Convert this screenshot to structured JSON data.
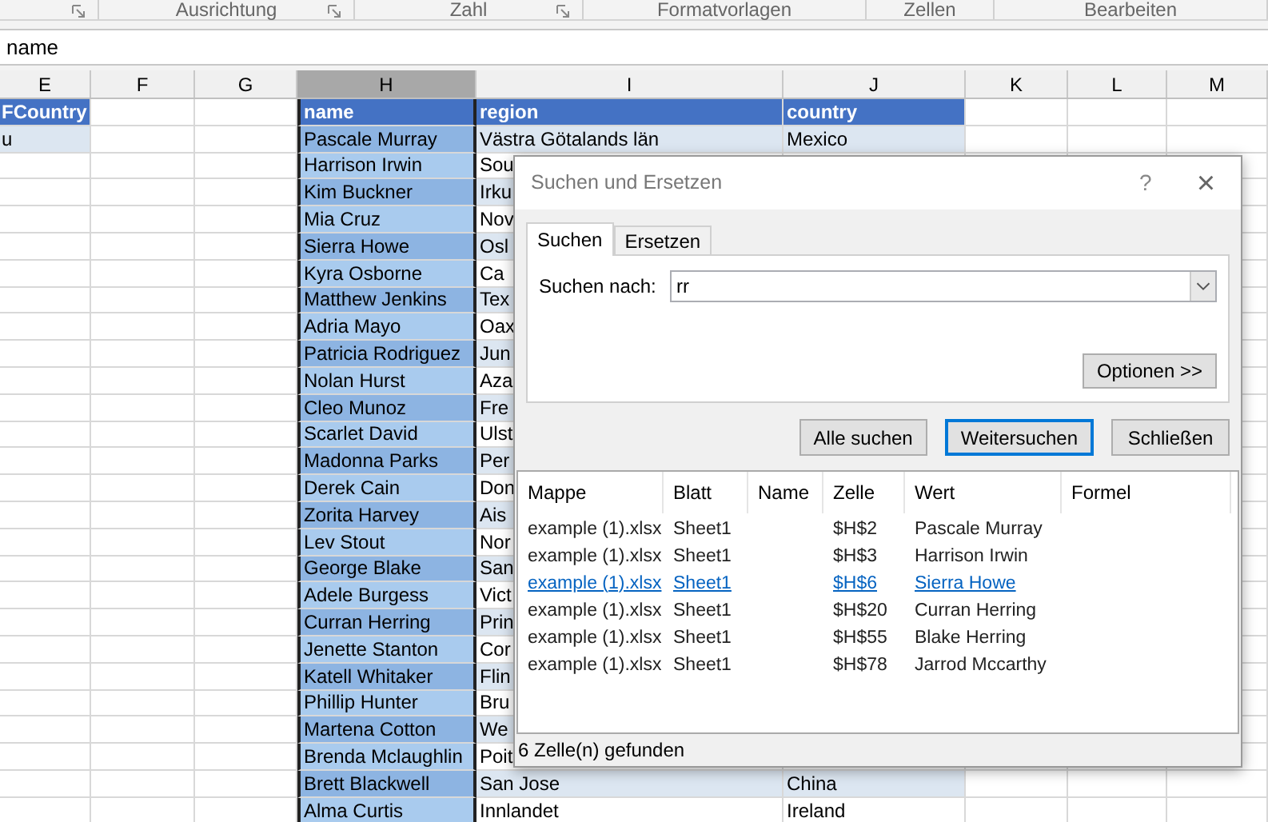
{
  "ribbon_groups": [
    {
      "launcher": true
    },
    {
      "label": "Ausrichtung",
      "launcher": true
    },
    {
      "label": "Zahl",
      "launcher": true
    },
    {
      "label": "Formatvorlagen",
      "launcher": false
    },
    {
      "label": "Zellen",
      "launcher": false
    },
    {
      "label": "Bearbeiten",
      "launcher": false
    }
  ],
  "formula_bar": {
    "value": "name"
  },
  "columns": [
    {
      "label": "E",
      "selected": false
    },
    {
      "label": "F",
      "selected": false
    },
    {
      "label": "G",
      "selected": false
    },
    {
      "label": "H",
      "selected": true
    },
    {
      "label": "I",
      "selected": false
    },
    {
      "label": "J",
      "selected": false
    },
    {
      "label": "K",
      "selected": false
    },
    {
      "label": "L",
      "selected": false
    },
    {
      "label": "M",
      "selected": false
    }
  ],
  "rows": [
    {
      "kind": "header",
      "e": "FCountry",
      "name": "name",
      "region": "region",
      "country": "country"
    },
    {
      "kind": "data",
      "e": "u",
      "name": "Pascale Murray",
      "region": "Västra Götalands län",
      "country": "Mexico"
    },
    {
      "kind": "data",
      "name": "Harrison Irwin",
      "region": "Sou"
    },
    {
      "kind": "data",
      "name": "Kim Buckner",
      "region": "Irku"
    },
    {
      "kind": "data",
      "name": "Mia Cruz",
      "region": "Nov"
    },
    {
      "kind": "data",
      "name": "Sierra Howe",
      "region": "Osl"
    },
    {
      "kind": "data",
      "name": "Kyra Osborne",
      "region": "Ca"
    },
    {
      "kind": "data",
      "name": "Matthew Jenkins",
      "region": "Tex"
    },
    {
      "kind": "data",
      "name": "Adria Mayo",
      "region": "Oax"
    },
    {
      "kind": "data",
      "name": "Patricia Rodriguez",
      "region": "Jun"
    },
    {
      "kind": "data",
      "name": "Nolan Hurst",
      "region": "Aza"
    },
    {
      "kind": "data",
      "name": "Cleo Munoz",
      "region": "Fre"
    },
    {
      "kind": "data",
      "name": "Scarlet David",
      "region": "Ulst"
    },
    {
      "kind": "data",
      "name": "Madonna Parks",
      "region": "Per"
    },
    {
      "kind": "data",
      "name": "Derek Cain",
      "region": "Don"
    },
    {
      "kind": "data",
      "name": "Zorita Harvey",
      "region": "Ais"
    },
    {
      "kind": "data",
      "name": "Lev Stout",
      "region": "Nor"
    },
    {
      "kind": "data",
      "name": "George Blake",
      "region": "San"
    },
    {
      "kind": "data",
      "name": "Adele Burgess",
      "region": "Vict"
    },
    {
      "kind": "data",
      "name": "Curran Herring",
      "region": "Prin"
    },
    {
      "kind": "data",
      "name": "Jenette Stanton",
      "region": "Cor"
    },
    {
      "kind": "data",
      "name": "Katell Whitaker",
      "region": "Flin"
    },
    {
      "kind": "data",
      "name": "Phillip Hunter",
      "region": "Bru"
    },
    {
      "kind": "data",
      "name": "Martena Cotton",
      "region": "We"
    },
    {
      "kind": "data",
      "name": "Brenda Mclaughlin",
      "region": "Poit"
    },
    {
      "kind": "data",
      "name": "Brett Blackwell",
      "region": "San Jose",
      "country": "China"
    },
    {
      "kind": "data",
      "name": "Alma Curtis",
      "region": "Innlandet",
      "country": "Ireland"
    }
  ],
  "dialog": {
    "title": "Suchen und Ersetzen",
    "help": "?",
    "close": "×",
    "tabs": [
      {
        "label": "Suchen",
        "selected": true
      },
      {
        "label": "Ersetzen",
        "selected": false
      }
    ],
    "search_label": "Suchen nach:",
    "search_value": "rr",
    "options_button": "Optionen >>",
    "buttons": [
      {
        "label": "Alle suchen",
        "default": false
      },
      {
        "label": "Weitersuchen",
        "default": true
      },
      {
        "label": "Schließen",
        "default": false
      }
    ],
    "results": {
      "columns": [
        "Mappe",
        "Blatt",
        "Name",
        "Zelle",
        "Wert",
        "Formel"
      ],
      "rows": [
        {
          "cells": [
            "example (1).xlsx",
            "Sheet1",
            "",
            "$H$2",
            "Pascale Murray",
            ""
          ],
          "selected": false
        },
        {
          "cells": [
            "example (1).xlsx",
            "Sheet1",
            "",
            "$H$3",
            "Harrison Irwin",
            ""
          ],
          "selected": false
        },
        {
          "cells": [
            "example (1).xlsx",
            "Sheet1",
            "",
            "$H$6",
            "Sierra Howe",
            ""
          ],
          "selected": true
        },
        {
          "cells": [
            "example (1).xlsx",
            "Sheet1",
            "",
            "$H$20",
            "Curran Herring",
            ""
          ],
          "selected": false
        },
        {
          "cells": [
            "example (1).xlsx",
            "Sheet1",
            "",
            "$H$55",
            "Blake Herring",
            ""
          ],
          "selected": false
        },
        {
          "cells": [
            "example (1).xlsx",
            "Sheet1",
            "",
            "$H$78",
            "Jarrod Mccarthy",
            ""
          ],
          "selected": false
        }
      ]
    },
    "status": "6 Zelle(n) gefunden"
  }
}
